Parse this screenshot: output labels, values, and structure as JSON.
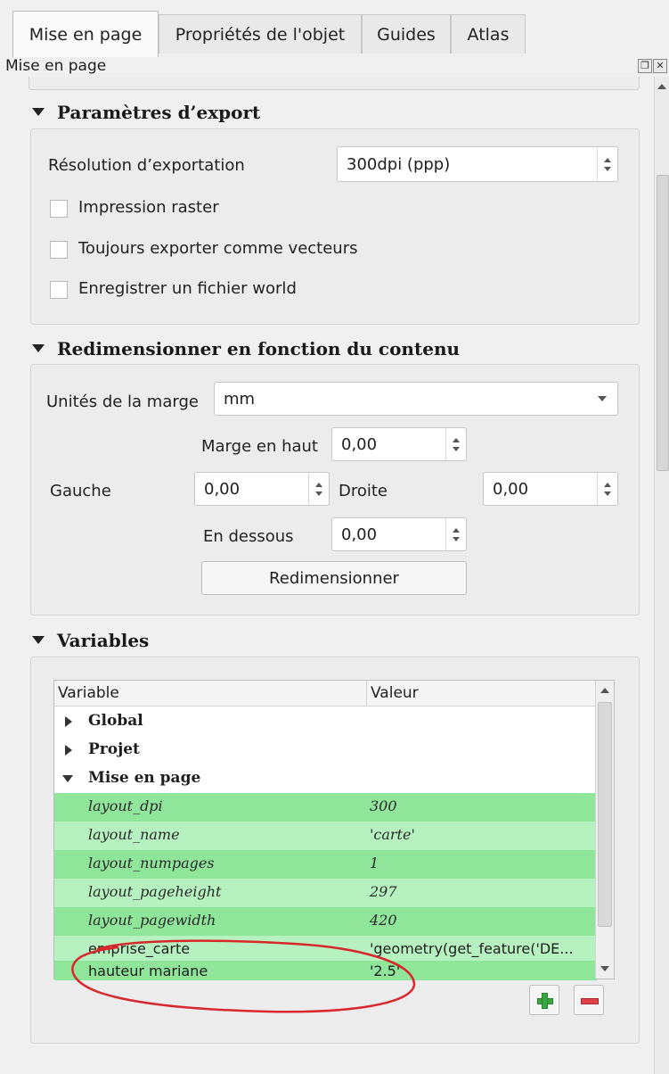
{
  "tabs": [
    {
      "label": "Mise en page",
      "active": true
    },
    {
      "label": "Propriétés de l'objet",
      "active": false
    },
    {
      "label": "Guides",
      "active": false
    },
    {
      "label": "Atlas",
      "active": false
    }
  ],
  "panel": {
    "title": "Mise en page",
    "float_icon": "float-icon",
    "close_icon": "close-icon"
  },
  "export": {
    "heading": "Paramètres d’export",
    "resolution_label": "Résolution d’exportation",
    "resolution_value": "300dpi (ppp)",
    "options": [
      {
        "label": "Impression raster",
        "checked": false
      },
      {
        "label": "Toujours exporter comme vecteurs",
        "checked": false
      },
      {
        "label": "Enregistrer un fichier world",
        "checked": false
      }
    ]
  },
  "resize": {
    "heading": "Redimensionner en fonction du contenu",
    "units_label": "Unités de la marge",
    "units_value": "mm",
    "top_label": "Marge en haut",
    "top_value": "0,00",
    "left_label": "Gauche",
    "left_value": "0,00",
    "right_label": "Droite",
    "right_value": "0,00",
    "bottom_label": "En dessous",
    "bottom_value": "0,00",
    "button": "Redimensionner"
  },
  "variables": {
    "heading": "Variables",
    "columns": [
      "Variable",
      "Valeur"
    ],
    "groups": [
      "Global",
      "Projet",
      "Mise en page"
    ],
    "rows": [
      {
        "name": "layout_dpi",
        "value": "300"
      },
      {
        "name": "layout_name",
        "value": "'carte'"
      },
      {
        "name": "layout_numpages",
        "value": "1"
      },
      {
        "name": "layout_pageheight",
        "value": "297"
      },
      {
        "name": "layout_pagewidth",
        "value": "420"
      },
      {
        "name": "emprise_carte",
        "value": "'geometry(get_feature('DE..."
      },
      {
        "name": "hauteur mariane",
        "value": "'2.5'"
      }
    ],
    "add_icon": "plus-icon",
    "remove_icon": "minus-icon"
  },
  "colors": {
    "row_green": "#8fe59a",
    "row_green_light": "#b6f2bf",
    "annotation_red": "#d9272e"
  }
}
